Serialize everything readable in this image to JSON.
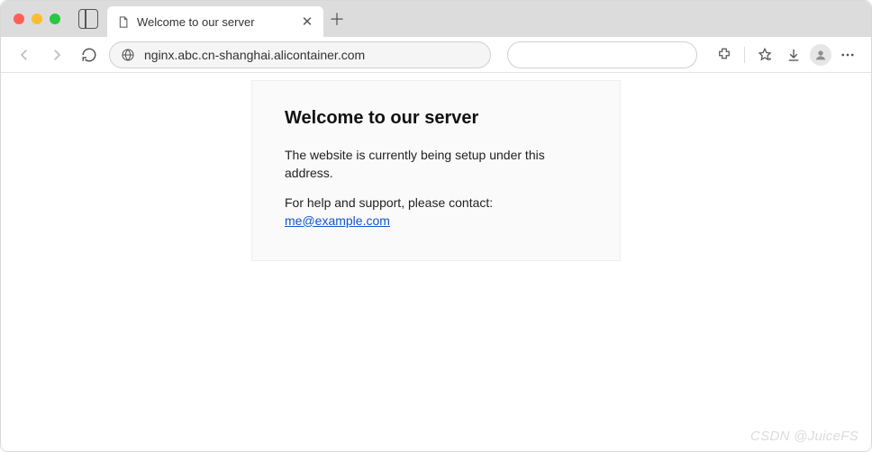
{
  "tab": {
    "title": "Welcome to our server"
  },
  "address": {
    "url": "nginx.abc.cn-shanghai.alicontainer.com"
  },
  "page": {
    "heading": "Welcome to our server",
    "body1": "The website is currently being setup under this address.",
    "body2_prefix": "For help and support, please contact: ",
    "email": "me@example.com"
  },
  "watermark": "CSDN @JuiceFS"
}
